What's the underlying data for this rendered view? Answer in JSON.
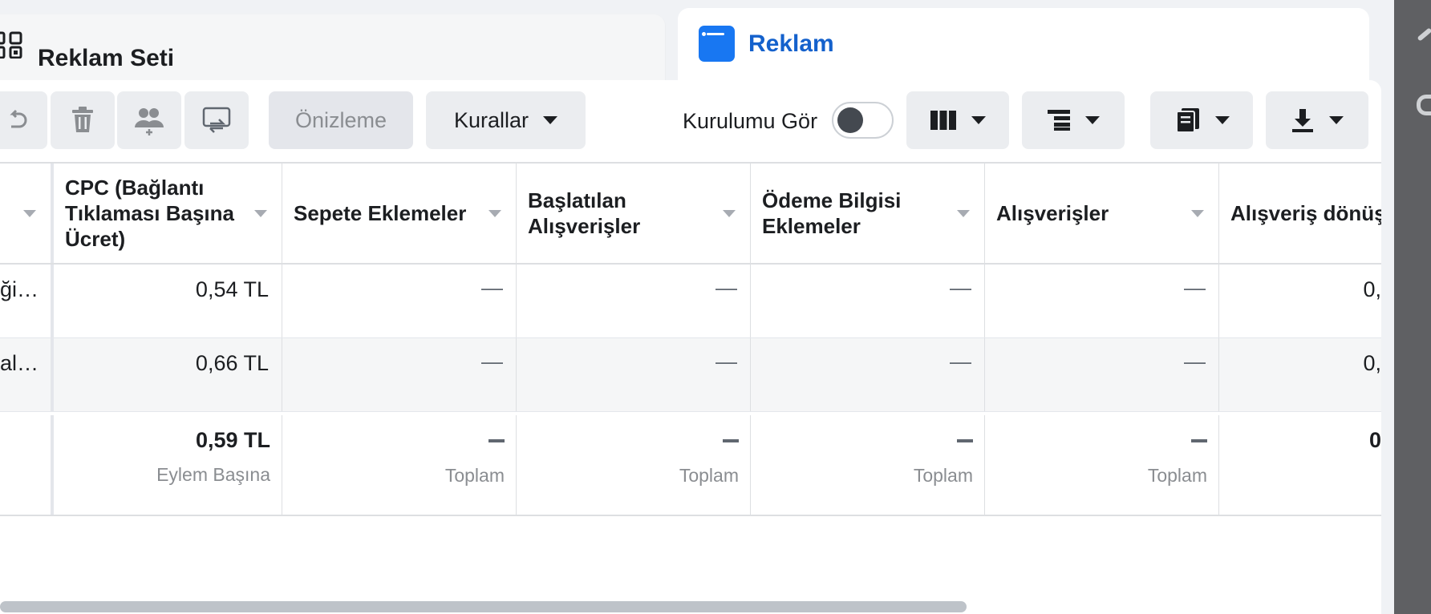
{
  "tabs": {
    "ad_set": {
      "label": "Reklam Seti"
    },
    "ad": {
      "label": "Reklam",
      "color": "#1461cc"
    }
  },
  "toolbar": {
    "preview_label": "Önizleme",
    "rules_label": "Kurallar",
    "view_setup_label": "Kurulumu Gör",
    "view_setup_on": false
  },
  "table": {
    "columns": [
      {
        "label": ""
      },
      {
        "label": "CPC (Bağlantı Tıklaması Başına Ücret)"
      },
      {
        "label": "Sepete Eklemeler"
      },
      {
        "label": "Başlatılan Alışverişler"
      },
      {
        "label": "Ödeme Bilgisi Eklemeler"
      },
      {
        "label": "Alışverişler"
      },
      {
        "label": "Alışveriş dönüşüm değe"
      }
    ],
    "rows": [
      {
        "name": "ği…",
        "cpc": "0,54 TL",
        "add_to_cart": "—",
        "checkouts": "—",
        "payment_info": "—",
        "purchases": "—",
        "purchase_value": "0,"
      },
      {
        "name": "al…",
        "cpc": "0,66 TL",
        "add_to_cart": "—",
        "checkouts": "—",
        "payment_info": "—",
        "purchases": "—",
        "purchase_value": "0,"
      }
    ],
    "totals": {
      "cpc": "0,59 TL",
      "cpc_sub": "Eylem Başına",
      "sub_total": "Toplam",
      "purchase_value": "0"
    }
  },
  "colors": {
    "accent": "#1877f2",
    "toolbar_button": "#ebedf0"
  }
}
